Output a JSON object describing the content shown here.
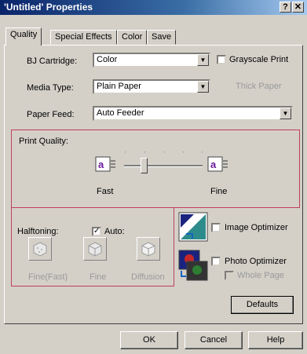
{
  "window": {
    "title": "'Untitled' Properties",
    "help_glyph": "?",
    "close_glyph": "✕"
  },
  "tabs": [
    "Quality",
    "Special Effects",
    "Color",
    "Save"
  ],
  "cartridge": {
    "label": "BJ Cartridge:",
    "value": "Color",
    "grayscale_label": "Grayscale Print",
    "grayscale_checked": false
  },
  "media": {
    "label": "Media Type:",
    "value": "Plain Paper",
    "thick_paper_label": "Thick Paper"
  },
  "feed": {
    "label": "Paper Feed:",
    "value": "Auto Feeder"
  },
  "print_quality": {
    "label": "Print Quality:",
    "fast_label": "Fast",
    "fine_label": "Fine",
    "level_fraction": 0.25
  },
  "halftoning": {
    "label": "Halftoning:",
    "auto_label": "Auto:",
    "auto_checked": true,
    "options": [
      "Fine(Fast)",
      "Fine",
      "Diffusion"
    ]
  },
  "optimizers": {
    "image_label": "Image Optimizer",
    "photo_label": "Photo Optimizer",
    "whole_page_label": "Whole Page"
  },
  "buttons": {
    "defaults": "Defaults",
    "ok": "OK",
    "cancel": "Cancel",
    "help": "Help"
  },
  "icons": {
    "quality_icon": "a-print-icon"
  }
}
